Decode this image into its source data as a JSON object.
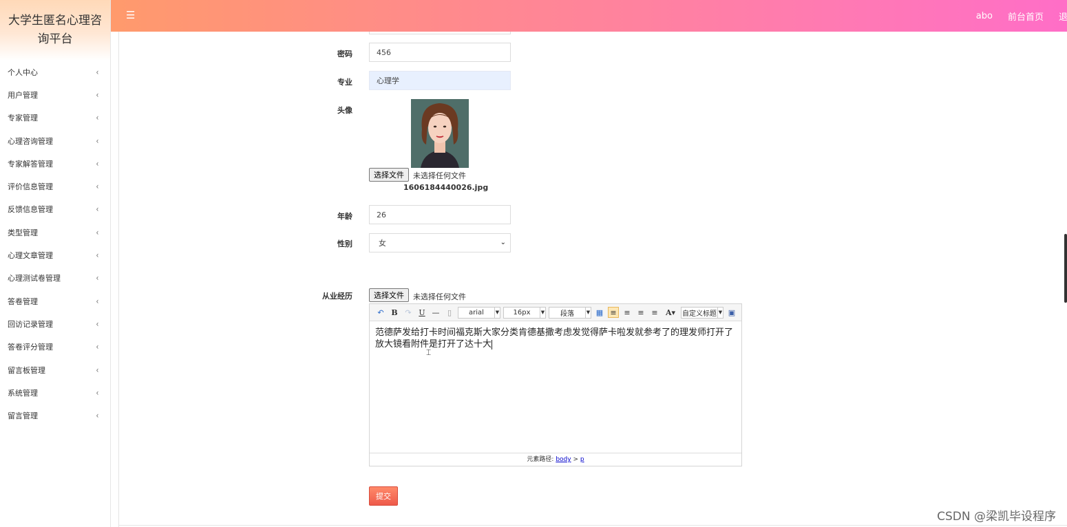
{
  "app": {
    "title": "大学生匿名心理咨询平台"
  },
  "header": {
    "menu_icon": "☰",
    "user": "abo",
    "home_link": "前台首页",
    "exit_link": "退出"
  },
  "sidebar": {
    "items": [
      {
        "label": "个人中心"
      },
      {
        "label": "用户管理"
      },
      {
        "label": "专家管理"
      },
      {
        "label": "心理咨询管理"
      },
      {
        "label": "专家解答管理"
      },
      {
        "label": "评价信息管理"
      },
      {
        "label": "反馈信息管理"
      },
      {
        "label": "类型管理"
      },
      {
        "label": "心理文章管理"
      },
      {
        "label": "心理测试卷管理"
      },
      {
        "label": "答卷管理"
      },
      {
        "label": "回访记录管理"
      },
      {
        "label": "答卷评分管理"
      },
      {
        "label": "留言板管理"
      },
      {
        "label": "系统管理"
      },
      {
        "label": "留言管理"
      }
    ],
    "chevron": "‹"
  },
  "form": {
    "password": {
      "label": "密码",
      "value": "456"
    },
    "major": {
      "label": "专业",
      "value": "心理学"
    },
    "avatar": {
      "label": "头像",
      "choose_button": "选择文件",
      "no_file": "未选择任何文件",
      "filename": "1606184440026.jpg"
    },
    "age": {
      "label": "年龄",
      "value": "26"
    },
    "gender": {
      "label": "性别",
      "value": "女"
    },
    "experience": {
      "label": "从业经历",
      "choose_button": "选择文件",
      "no_file": "未选择任何文件",
      "content": "范德萨发给打卡时间福克斯大家分类肯德基撒考虑发觉得萨卡啦发就参考了的理发师打开了放大镜看附件是打开了达十大"
    },
    "submit": "提交"
  },
  "editor": {
    "font": "arial",
    "size": "16px",
    "paragraph": "段落",
    "custom_title": "自定义标题",
    "status_prefix": "元素路径:",
    "path_body": "body",
    "path_sep": ">",
    "path_p": "p"
  },
  "watermark": "CSDN @梁凯毕设程序",
  "colors": {
    "header_start": "#ff9a6c",
    "header_end": "#ff6ec7",
    "submit": "#ee5a4a"
  }
}
